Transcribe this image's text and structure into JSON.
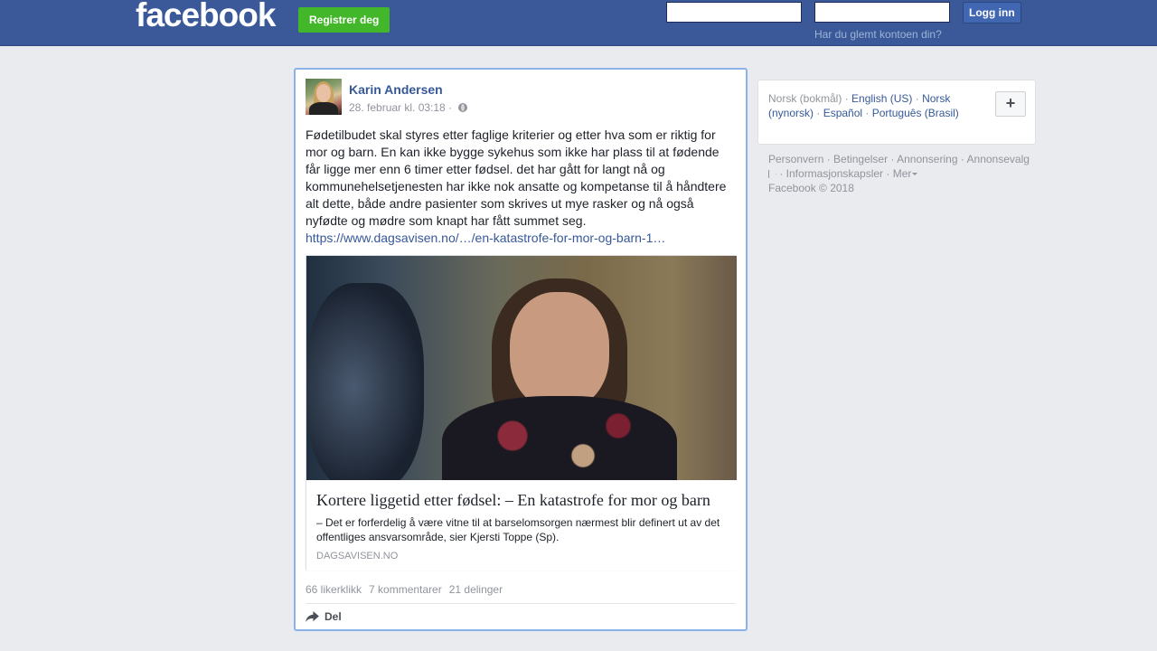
{
  "header": {
    "logo": "facebook",
    "register_label": "Registrer deg",
    "email_value": "",
    "password_value": "",
    "login_label": "Logg inn",
    "forgot_label": "Har du glemt kontoen din?"
  },
  "post": {
    "author": "Karin Andersen",
    "timestamp": "28. februar kl. 03:18 ·",
    "privacy_icon": "globe-icon",
    "text": "Fødetilbudet skal styres etter faglige kriterier og etter hva som er riktig for mor og barn. En kan ikke bygge sykehus som ikke har plass til at fødende får ligge mer enn 6 timer etter fødsel. det har gått for langt nå og kommunehelsetjenesten har ikke nok ansatte og kompetanse til å håndtere alt dette, både andre pasienter som skrives ut mye rasker og nå også nyfødte og mødre som knapt har fått summet seg.",
    "link": "https://www.dagsavisen.no/…/en-katastrofe-for-mor-og-barn-1…",
    "card": {
      "title": "Kortere liggetid etter fødsel: – En katastrofe for mor og barn",
      "description": "– Det er forferdelig å være vitne til at barselomsorgen nærmest blir definert ut av det offentliges ansvarsområde, sier Kjersti Toppe (Sp).",
      "domain": "DAGSAVISEN.NO"
    },
    "stats": {
      "likes": "66 likerklikk",
      "comments": "7 kommentarer",
      "shares": "21 delinger"
    },
    "share_label": "Del"
  },
  "sidebar": {
    "current_language": "Norsk (bokmål)",
    "languages": [
      "English (US)",
      "Norsk (nynorsk)",
      "Español",
      "Português (Brasil)"
    ],
    "add_label": "+",
    "footer": {
      "links": [
        "Personvern",
        "Betingelser",
        "Annonsering",
        "Annonsevalg",
        "Informasjonskapsler",
        "Mer"
      ],
      "copyright": "Facebook © 2018"
    }
  }
}
